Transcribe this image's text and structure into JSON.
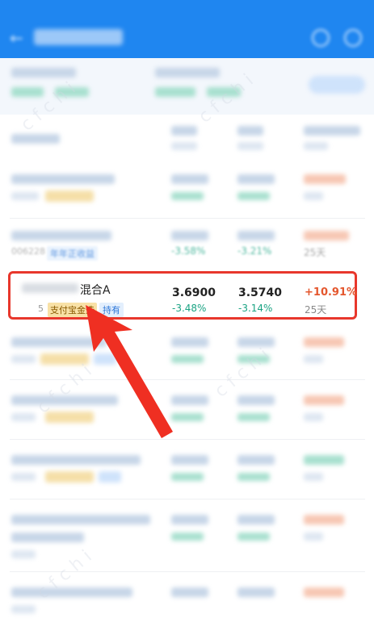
{
  "fund_list": {
    "rows": [
      {
        "name": "混合A",
        "code": "5",
        "tags": [
          "支付宝金选",
          "持有"
        ],
        "nav_1": "3.6900",
        "pct_1": "-3.48%",
        "nav_2": "3.5740",
        "pct_2": "-3.14%",
        "gain": "+10.91%",
        "days": "25天"
      },
      {
        "name": "",
        "code": "006228",
        "tags": [
          "年年正收益"
        ],
        "nav_1": "",
        "pct_1": "-3.58%",
        "nav_2": "",
        "pct_2": "-3.21%",
        "gain": "",
        "days": "25天"
      }
    ]
  },
  "colors": {
    "brand_blue": "#1f86f0",
    "highlight_red": "#e8372c",
    "gain_orange": "#e4572e",
    "loss_green": "#1aa383"
  },
  "icons": [
    "back-arrow-icon",
    "search-icon",
    "settings-icon",
    "pointer-arrow-icon"
  ]
}
